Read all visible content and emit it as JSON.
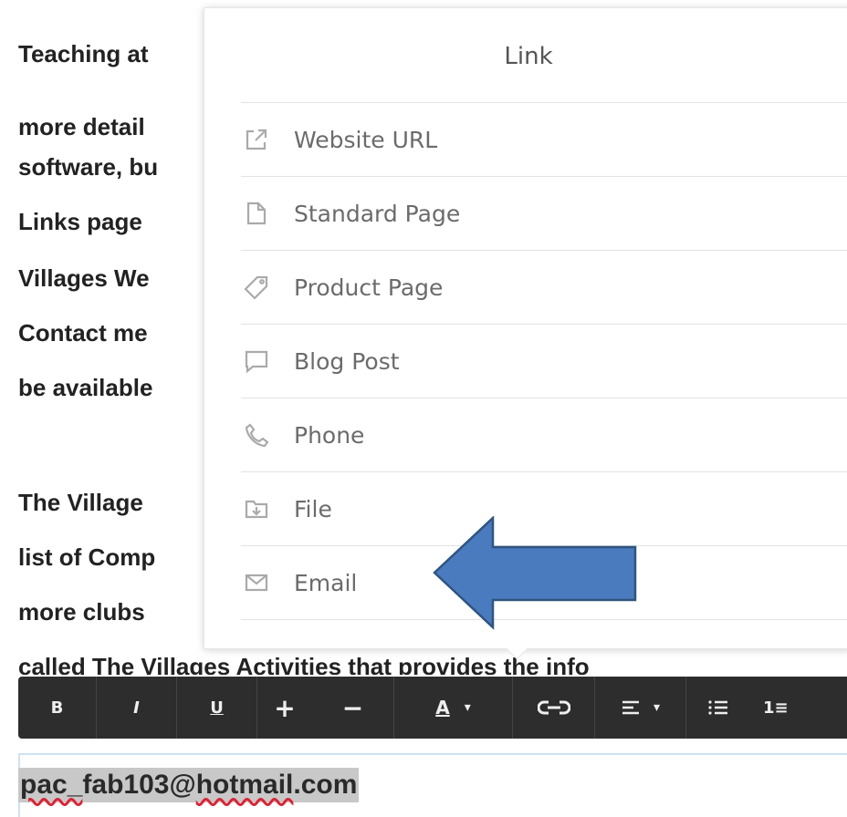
{
  "background_text": {
    "lines": [
      "Teaching at",
      "more detail",
      "software, bu",
      "Links page",
      "Villages We",
      "Contact me",
      "be available",
      "",
      "The Village",
      "list of Comp",
      "more clubs",
      "called The Villages Activities that provides the info"
    ]
  },
  "popup": {
    "title": "Link",
    "items": [
      {
        "label": "Website URL",
        "icon": "external-link-icon"
      },
      {
        "label": "Standard Page",
        "icon": "page-icon"
      },
      {
        "label": "Product Page",
        "icon": "tag-icon"
      },
      {
        "label": "Blog Post",
        "icon": "speech-bubble-icon"
      },
      {
        "label": "Phone",
        "icon": "phone-icon"
      },
      {
        "label": "File",
        "icon": "folder-icon"
      },
      {
        "label": "Email",
        "icon": "envelope-icon"
      }
    ]
  },
  "annotation": {
    "arrow_color": "#4a7bbf",
    "points_to": "Email"
  },
  "toolbar": {
    "bold": "B",
    "italic": "I",
    "underline": "U",
    "increase_size": "+",
    "decrease_size": "−",
    "text_color": "A",
    "text_color_caret": "▾",
    "link": "⊝",
    "align_caret": "▾",
    "numbered_list": "1≡"
  },
  "editor": {
    "email_prefix": "pac_",
    "email_user": "fab103",
    "email_at": "@",
    "email_domain": "hotmail",
    "email_tld": ".com"
  }
}
